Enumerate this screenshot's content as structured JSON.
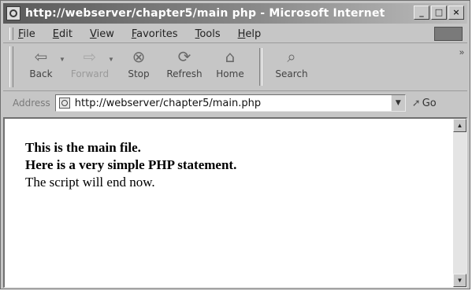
{
  "window": {
    "title": "http://webserver/chapter5/main php - Microsoft Internet",
    "buttons": {
      "minimize": "_",
      "maximize": "□",
      "close": "×"
    }
  },
  "menu": {
    "items": [
      "File",
      "Edit",
      "View",
      "Favorites",
      "Tools",
      "Help"
    ]
  },
  "toolbar": {
    "buttons": [
      {
        "label": "Back",
        "icon": "back-arrow-icon",
        "glyph": "⇦"
      },
      {
        "label": "Forward",
        "icon": "forward-arrow-icon",
        "glyph": "⇨"
      },
      {
        "label": "Stop",
        "icon": "stop-icon",
        "glyph": "⊗"
      },
      {
        "label": "Refresh",
        "icon": "refresh-icon",
        "glyph": "⟳"
      },
      {
        "label": "Home",
        "icon": "home-icon",
        "glyph": "⌂"
      },
      {
        "label": "Search",
        "icon": "search-icon",
        "glyph": "⌕"
      }
    ]
  },
  "address": {
    "label": "Address",
    "url": "http://webserver/chapter5/main.php",
    "go_label": "Go"
  },
  "page": {
    "line1": "This is the main file.",
    "line2": "Here is a very simple PHP statement.",
    "line3": "The script will end now."
  }
}
